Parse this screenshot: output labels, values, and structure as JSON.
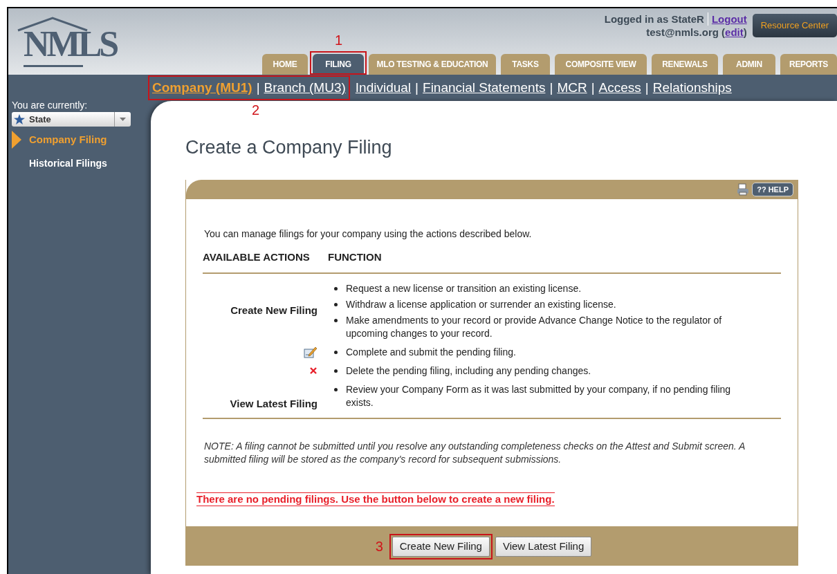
{
  "logo": {
    "text": "NMLS"
  },
  "account": {
    "logged_in": "Logged in as StateR",
    "logout": "Logout",
    "email_prefix": "test@nmls.org (",
    "edit": "edit",
    "email_suffix": ")"
  },
  "resource_button": "Resource Center",
  "tabs": [
    {
      "label": "HOME",
      "selected": false
    },
    {
      "label": "FILING",
      "selected": true,
      "callout": "1"
    },
    {
      "label": "MLO TESTING & EDUCATION",
      "selected": false
    },
    {
      "label": "TASKS",
      "selected": false
    },
    {
      "label": "COMPOSITE VIEW",
      "selected": false
    },
    {
      "label": "RENEWALS",
      "selected": false
    },
    {
      "label": "ADMIN",
      "selected": false
    },
    {
      "label": "REPORTS",
      "selected": false
    }
  ],
  "subnav": {
    "separator": "|",
    "groups": [
      {
        "callout": "2",
        "links": [
          {
            "label": "Company (MU1)",
            "selected": true
          },
          {
            "label": "Branch (MU3)",
            "selected": false
          }
        ]
      },
      {
        "links": [
          {
            "label": "Individual",
            "selected": false
          },
          {
            "label": "Financial Statements",
            "selected": false
          },
          {
            "label": "MCR",
            "selected": false
          },
          {
            "label": "Access",
            "selected": false
          },
          {
            "label": "Relationships",
            "selected": false
          }
        ]
      }
    ]
  },
  "sidebar": {
    "context_label": "You are currently:",
    "context_select": "State",
    "items": [
      {
        "label": "Company Filing",
        "selected": true
      },
      {
        "label": "Historical Filings",
        "selected": false
      }
    ]
  },
  "title": "Create a Company Filing",
  "panel": {
    "help": {
      "marks": "??",
      "label": "HELP"
    },
    "intro": "You can manage filings for your company using the actions described below.",
    "columns": [
      "AVAILABLE ACTIONS",
      "FUNCTION"
    ],
    "rows": [
      {
        "kind": "text",
        "action": "Create New Filing",
        "bullets": [
          "Request a new license or transition an existing license.",
          "Withdraw a license application or surrender an existing license.",
          "Make amendments to your record or provide Advance Change Notice to the regulator of upcoming changes to your record."
        ]
      },
      {
        "kind": "edit",
        "bullets": [
          "Complete and submit the pending filing."
        ]
      },
      {
        "kind": "delete",
        "bullets": [
          "Delete the pending filing, including any pending changes."
        ]
      },
      {
        "kind": "text",
        "action": "View Latest Filing",
        "bullets": [
          "Review your Company Form as it was last submitted by your company, if no pending filing exists."
        ]
      }
    ],
    "note": "NOTE: A filing cannot be submitted until you resolve any outstanding completeness checks on the Attest and Submit screen. A submitted filing will be stored as the company's record for subsequent submissions.",
    "message": "There are no pending filings. Use the button below to create a new filing.",
    "buttons": [
      {
        "label": "Create New Filing",
        "callout": "3"
      },
      {
        "label": "View Latest Filing"
      }
    ]
  }
}
